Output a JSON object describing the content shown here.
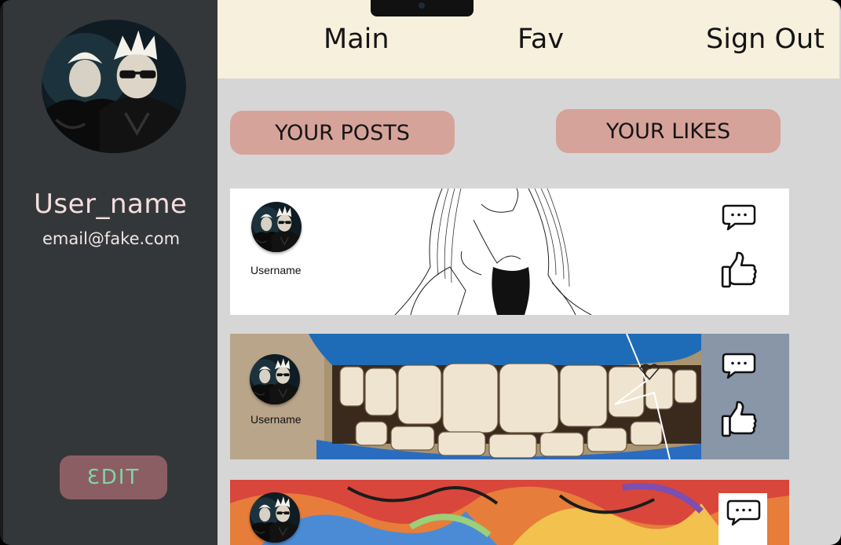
{
  "profile": {
    "username": "User_name",
    "email": "email@fake.com",
    "edit_label": "ƐDIT",
    "avatar_icon": "profile-photo"
  },
  "nav": {
    "main": "Main",
    "fav": "Fav",
    "sign_out": "Sign Out"
  },
  "tabs": {
    "your_posts": "YOUR POSTS",
    "your_likes": "YOUR LIKES"
  },
  "posts": [
    {
      "username": "Username",
      "image": "line-drawing-girl",
      "icons": [
        "comment-icon",
        "thumbs-up-icon"
      ]
    },
    {
      "username": "Username",
      "image": "graffiti-teeth",
      "icons": [
        "comment-icon",
        "thumbs-up-icon"
      ]
    },
    {
      "username": "",
      "image": "graffiti-colorful",
      "icons": [
        "comment-icon"
      ]
    }
  ],
  "colors": {
    "sidebar": "#343739",
    "topbar": "#f7f0dd",
    "main_bg": "#d6d6d6",
    "tab_button": "#d6a39a",
    "edit_button": "#8b5e63",
    "edit_text": "#7fd6a6"
  }
}
